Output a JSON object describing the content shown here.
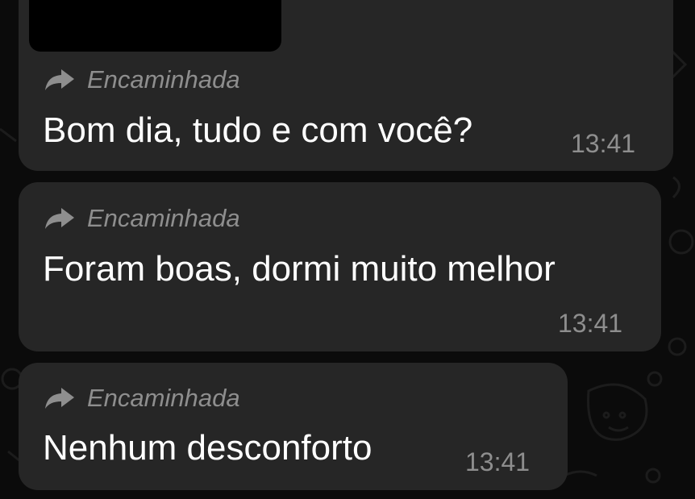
{
  "conversation": {
    "messages": [
      {
        "forwarded_label": "Encaminhada",
        "text": "Bom dia, tudo e com você?",
        "time": "13:41"
      },
      {
        "forwarded_label": "Encaminhada",
        "text": "Foram boas, dormi muito melhor",
        "time": "13:41"
      },
      {
        "forwarded_label": "Encaminhada",
        "text": "Nenhum desconforto",
        "time": "13:41"
      }
    ]
  },
  "colors": {
    "background": "#0b0b0b",
    "bubble": "#262626",
    "message_text": "#ffffff",
    "meta_text": "#8e8e8e"
  },
  "icons": [
    "forward-arrow-icon"
  ]
}
